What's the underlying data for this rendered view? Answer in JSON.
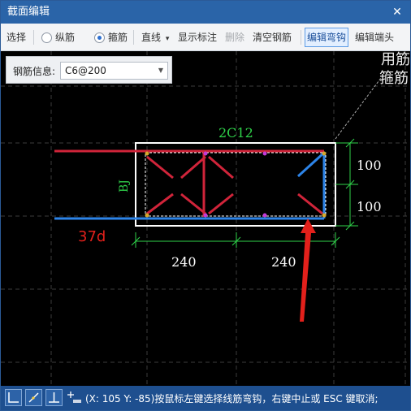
{
  "window": {
    "title": "截面编辑",
    "close_glyph": "✕"
  },
  "toolbar": {
    "select": "选择",
    "longitudinal": "纵筋",
    "stirrup": "箍筋",
    "line": "直线",
    "line_arrow": "▾",
    "show_annotation": "显示标注",
    "delete": "删除",
    "clear_rebar": "清空钢筋",
    "edit_hook": "编辑弯钩",
    "edit_end": "编辑端头",
    "selected_radio": "stirrup"
  },
  "rebar_info": {
    "label": "钢筋信息:",
    "value": "C6@200"
  },
  "canvas": {
    "corner_text_1": "用筋",
    "corner_text_2": "箍筋",
    "top_rebar": "2C12",
    "side_label": "BJ",
    "anchor_length": "37d",
    "dim_right_1": "100",
    "dim_right_2": "100",
    "dim_bottom_1": "240",
    "dim_bottom_2": "240"
  },
  "statusbar": {
    "text": "(X: 105 Y: -85)按鼠标左键选择线筋弯钩，右键中止或 ESC 键取消;"
  },
  "colors": {
    "title_bar": "#2a64a8",
    "canvas_bg": "#000000",
    "red_rebar": "#d0243a",
    "blue_rebar": "#2d84e8",
    "dimension_green": "#2fd24a",
    "arrow_red": "#e3201b"
  }
}
